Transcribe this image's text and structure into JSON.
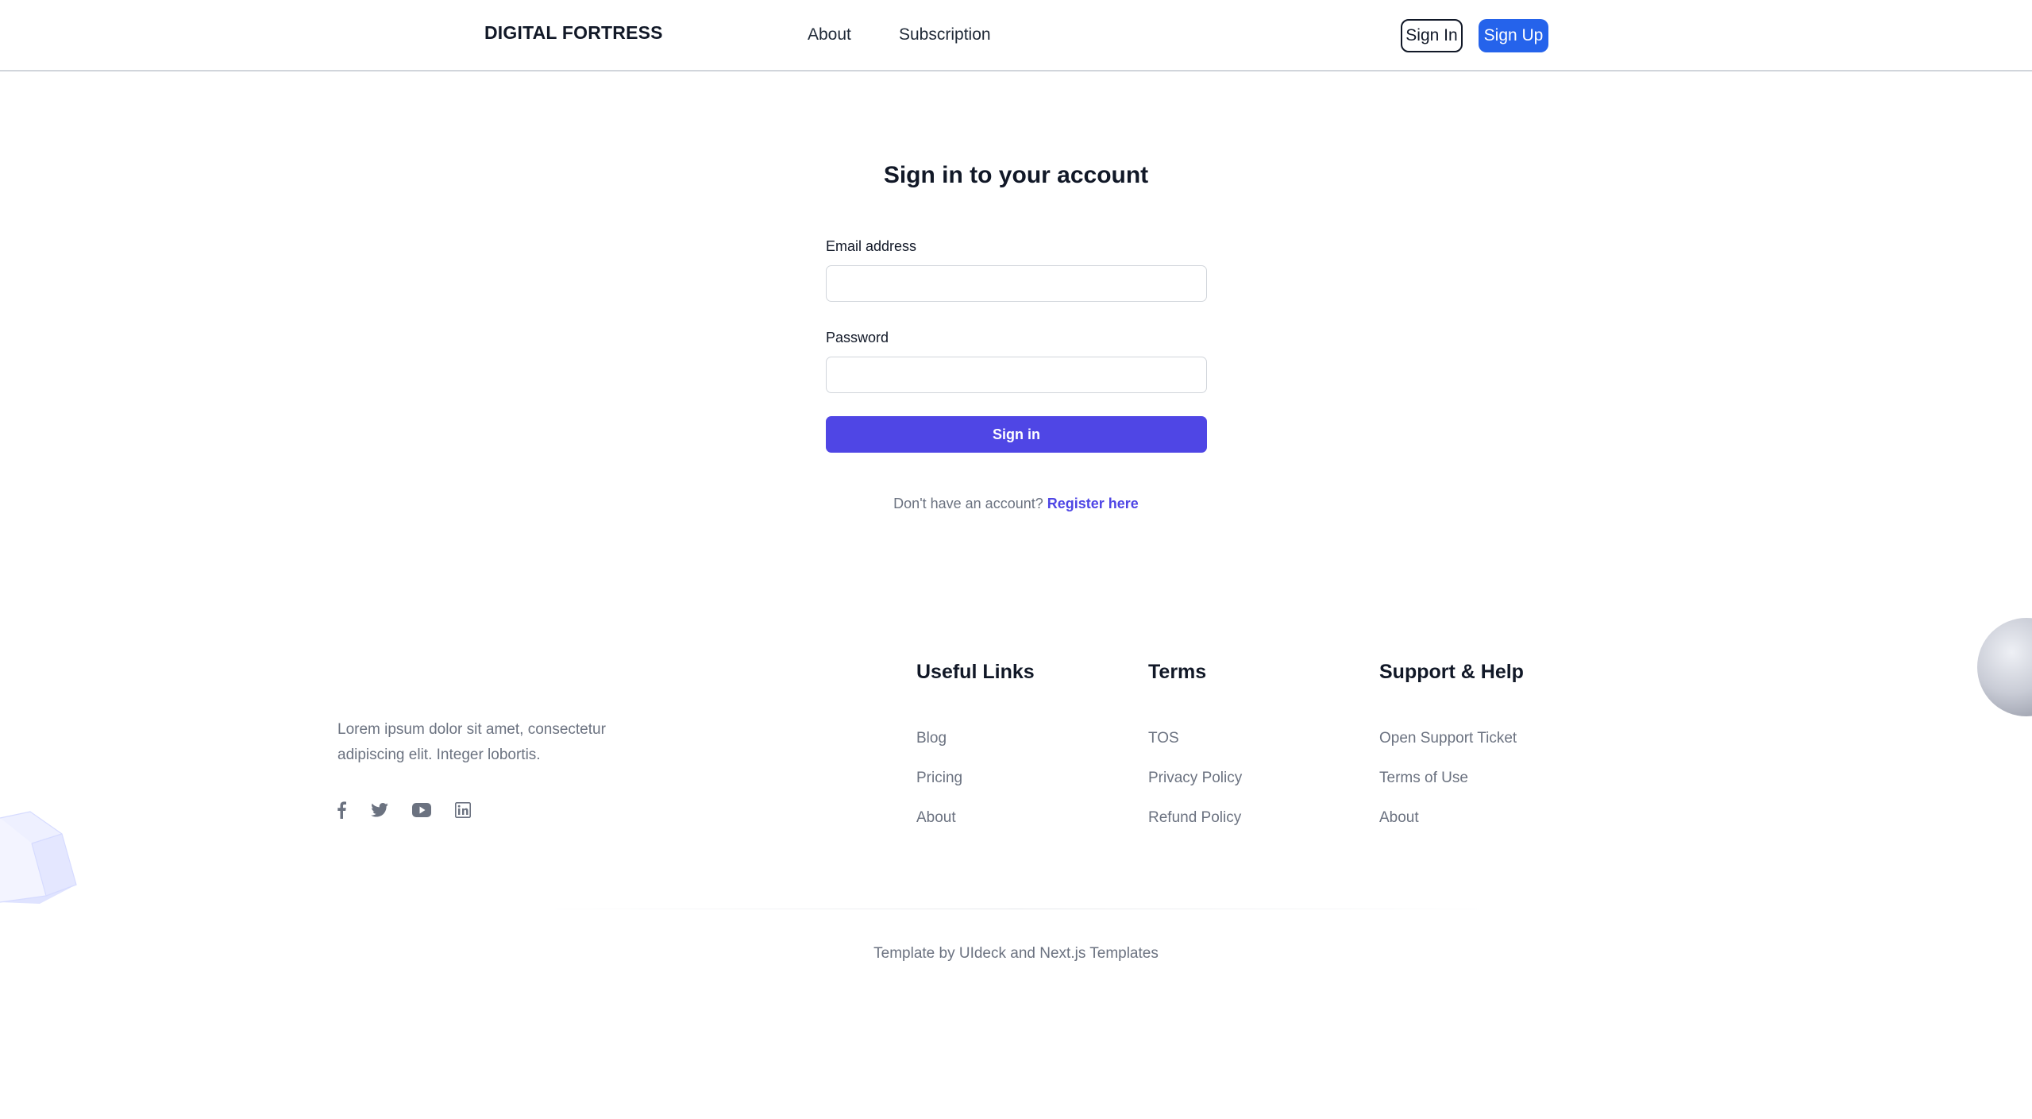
{
  "header": {
    "logo": "DIGITAL FORTRESS",
    "nav": [
      "About",
      "Subscription"
    ],
    "sign_in": "Sign In",
    "sign_up": "Sign Up"
  },
  "form": {
    "title": "Sign in to your account",
    "email_label": "Email address",
    "email_value": "",
    "password_label": "Password",
    "password_value": "",
    "submit": "Sign in",
    "register_prompt": "Don't have an account?",
    "register_link": "Register here"
  },
  "footer": {
    "description": "Lorem ipsum dolor sit amet, consectetur adipiscing elit. Integer lobortis.",
    "social_icons": [
      "facebook-icon",
      "twitter-icon",
      "youtube-icon",
      "linkedin-icon"
    ],
    "columns": [
      {
        "title": "Useful Links",
        "links": [
          "Blog",
          "Pricing",
          "About"
        ]
      },
      {
        "title": "Terms",
        "links": [
          "TOS",
          "Privacy Policy",
          "Refund Policy"
        ]
      },
      {
        "title": "Support & Help",
        "links": [
          "Open Support Ticket",
          "Terms of Use",
          "About"
        ]
      }
    ],
    "credit": "Template by UIdeck and Next.js Templates"
  },
  "colors": {
    "primary": "#4f46e5",
    "signup_blue": "#2563eb",
    "text_dark": "#111827",
    "text_muted": "#6b7280",
    "border": "#d1d5db"
  }
}
